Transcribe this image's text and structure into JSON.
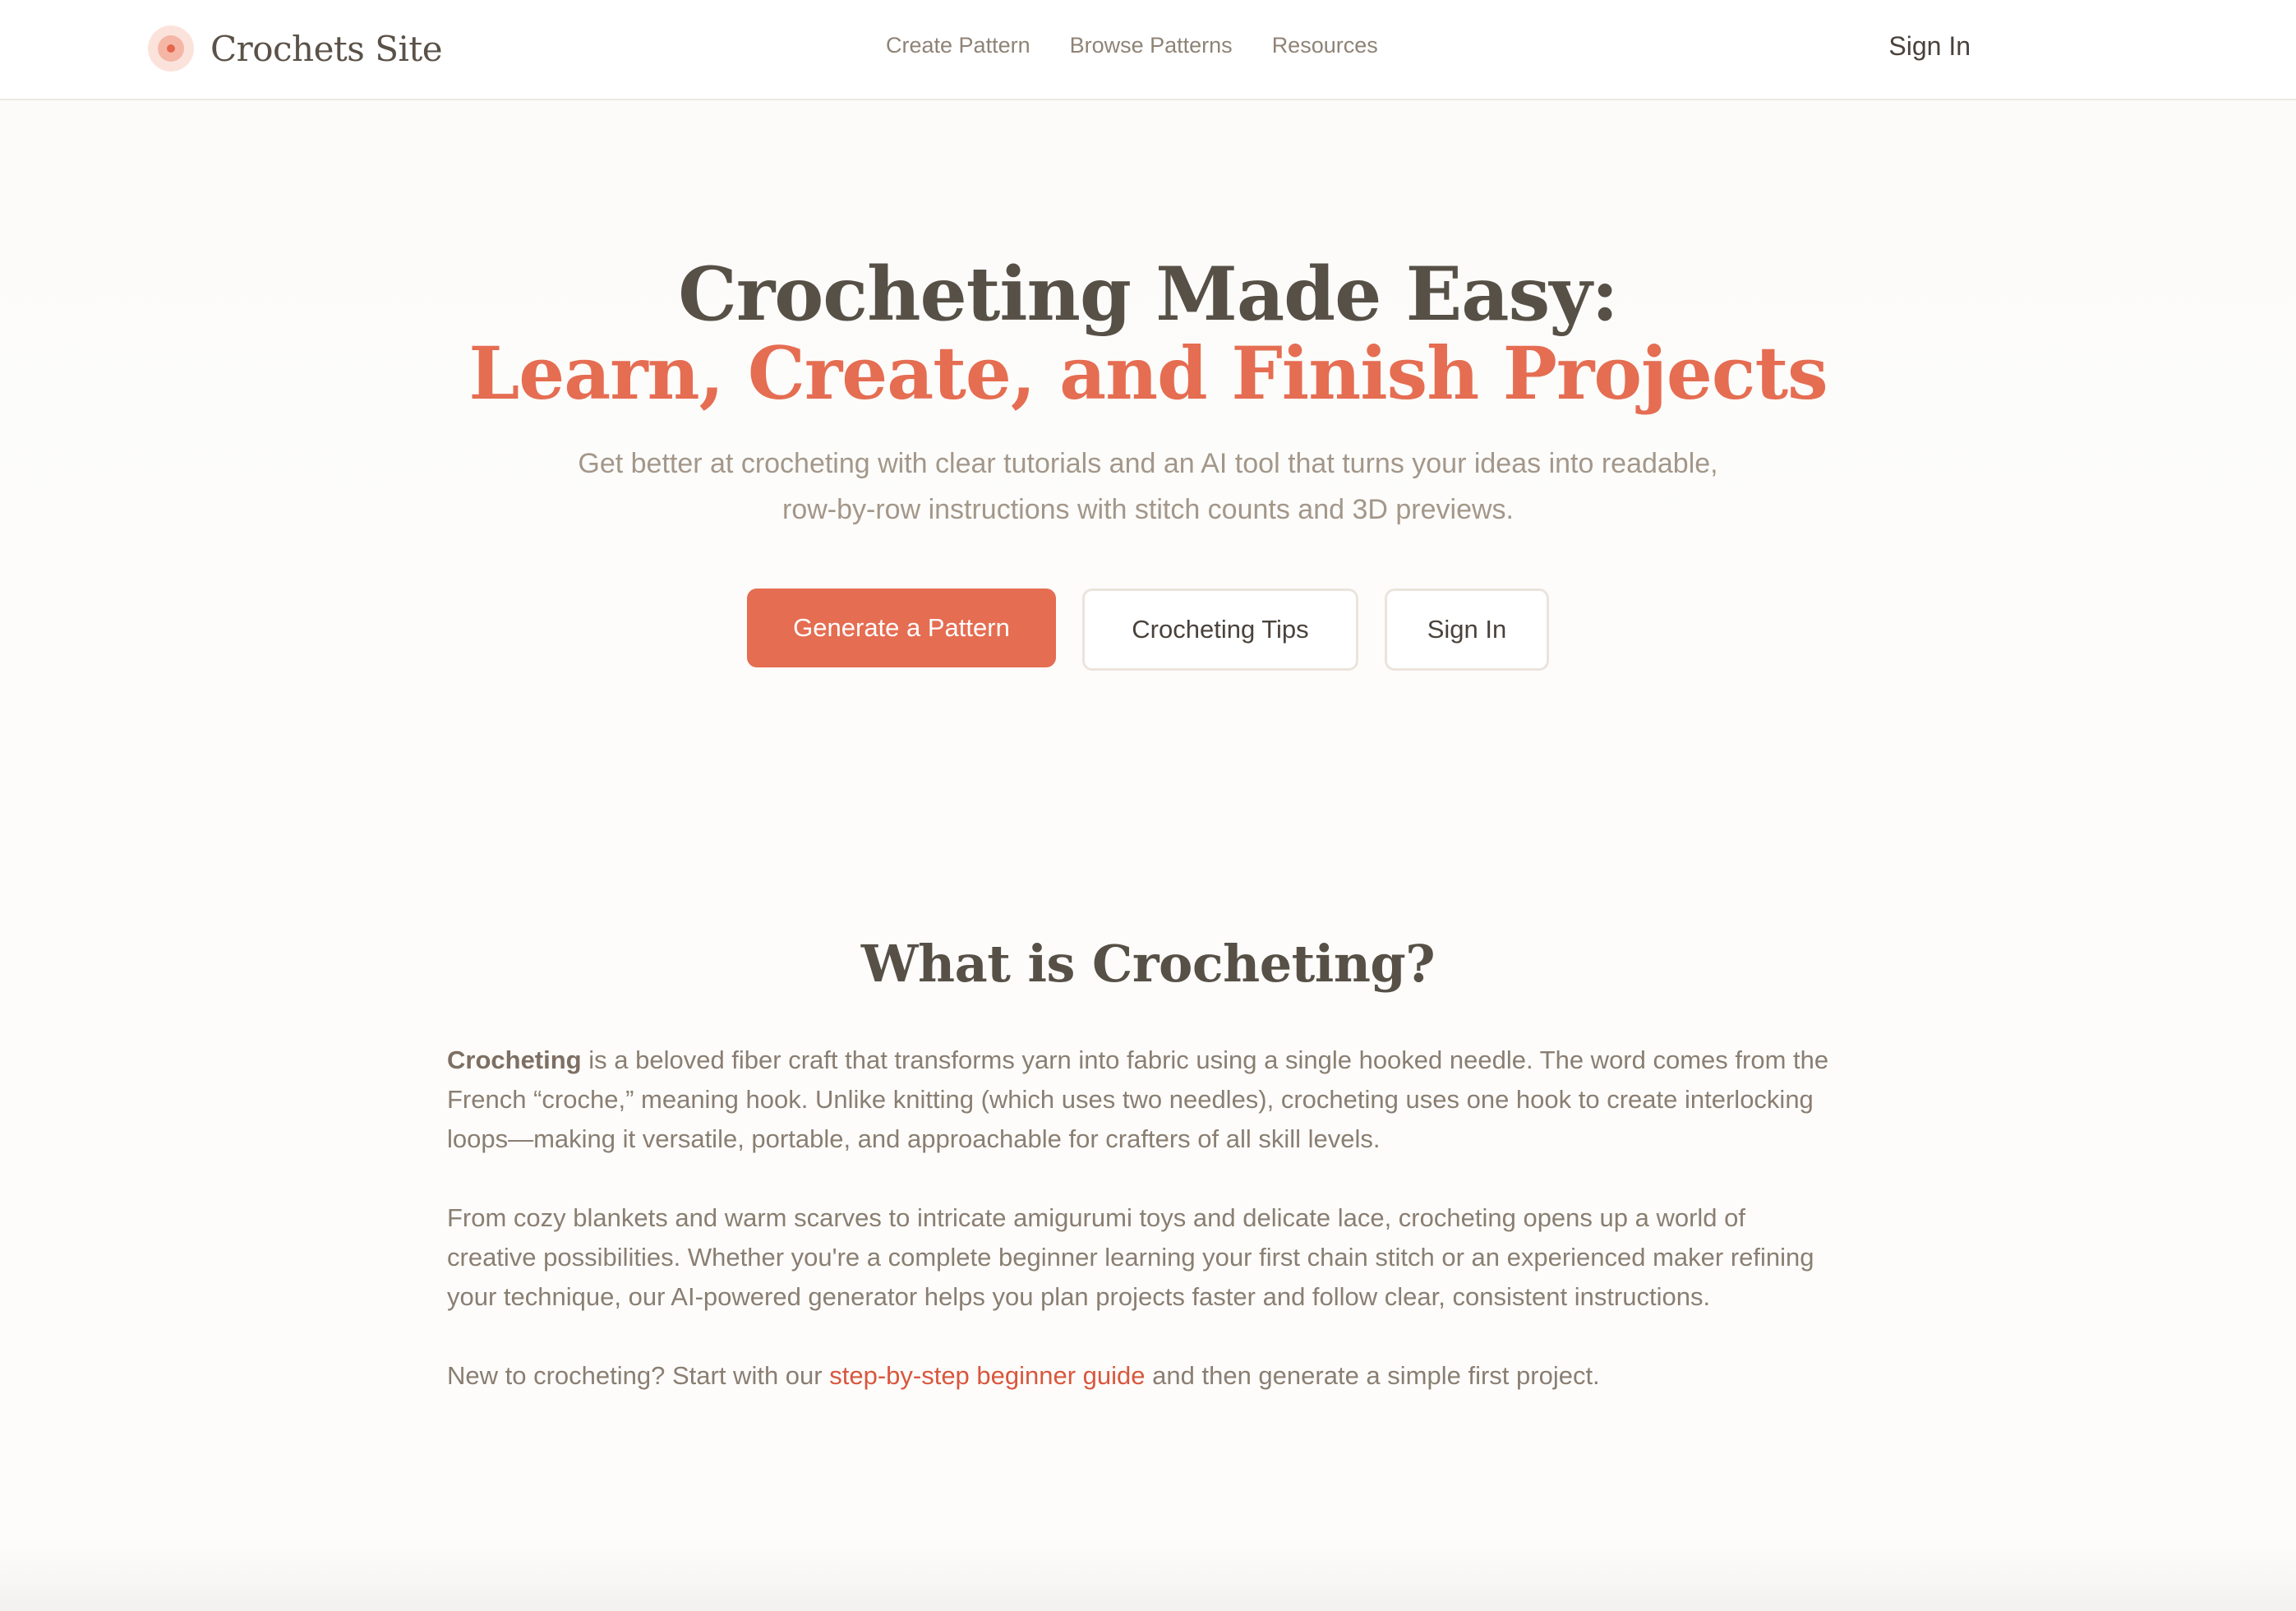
{
  "header": {
    "logo_text": "Crochets Site",
    "nav": [
      {
        "label": "Create Pattern"
      },
      {
        "label": "Browse Patterns"
      },
      {
        "label": "Resources"
      }
    ],
    "sign_in": "Sign In"
  },
  "hero": {
    "title_line1": "Crocheting Made Easy:",
    "title_line2": "Learn, Create, and Finish Projects",
    "subtitle": "Get better at crocheting with clear tutorials and an AI tool that turns your ideas into readable, row-by-row instructions with stitch counts and 3D previews.",
    "buttons": {
      "primary": "Generate a Pattern",
      "tips": "Crocheting Tips",
      "sign_in": "Sign In"
    }
  },
  "about": {
    "title": "What is Crocheting?",
    "p1_bold": "Crocheting",
    "p1_rest": " is a beloved fiber craft that transforms yarn into fabric using a single hooked needle. The word comes from the French “croche,” meaning hook. Unlike knitting (which uses two needles), crocheting uses one hook to create interlocking loops—making it versatile, portable, and approachable for crafters of all skill levels.",
    "p2": "From cozy blankets and warm scarves to intricate amigurumi toys and delicate lace, crocheting opens up a world of creative possibilities. Whether you're a complete beginner learning your first chain stitch or an experienced maker refining your technique, our AI-powered generator helps you plan projects faster and follow clear, consistent instructions.",
    "p3_before": "New to crocheting? Start with our ",
    "p3_link": "step-by-step beginner guide",
    "p3_after": " and then generate a simple first project."
  },
  "colors": {
    "accent": "#e56d52",
    "link": "#d9573d",
    "heading": "#575047",
    "body_text": "#8a7e72",
    "background": "#fdfcfa"
  },
  "icons": {
    "logo": "yarn-ball-icon"
  }
}
